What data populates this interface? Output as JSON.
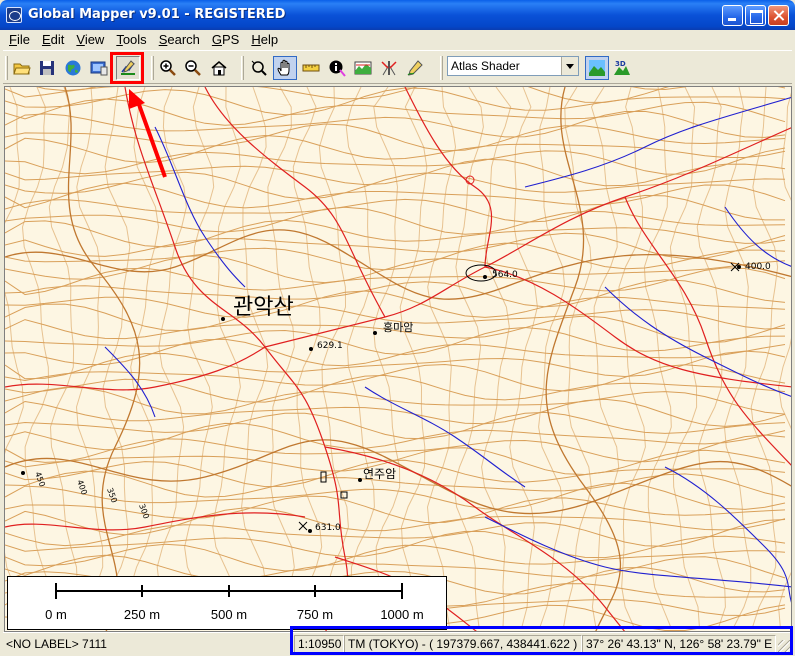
{
  "window": {
    "title": "Global Mapper v9.01 - REGISTERED"
  },
  "menu": {
    "items": [
      {
        "label": "File",
        "key": "F",
        "rest": "ile"
      },
      {
        "label": "Edit",
        "key": "E",
        "rest": "dit"
      },
      {
        "label": "View",
        "key": "V",
        "rest": "iew"
      },
      {
        "label": "Tools",
        "key": "T",
        "rest": "ools"
      },
      {
        "label": "Search",
        "key": "S",
        "rest": "earch"
      },
      {
        "label": "GPS",
        "key": "G",
        "rest": "PS"
      },
      {
        "label": "Help",
        "key": "H",
        "rest": "elp"
      }
    ]
  },
  "toolbar": {
    "icons": [
      "open-folder-icon",
      "save-icon",
      "globe-icon",
      "screen-capture-icon",
      "digitizer-icon",
      "zoom-in-icon",
      "zoom-out-icon",
      "home-icon",
      "zoom-tool-icon",
      "pan-hand-icon",
      "measure-ruler-icon",
      "feature-info-icon",
      "path-profile-icon",
      "3d-view-icon",
      "digitize-pencil-icon"
    ],
    "shader_select": "Atlas Shader",
    "shader_3d_label": "3D"
  },
  "map": {
    "labels": {
      "mountain_name": "관악산",
      "temple_1": "홍마암",
      "temple_2": "연주암",
      "peak_1": "564.0",
      "peak_2": "629.1",
      "peak_3": "631.0",
      "peak_4": "400.0",
      "contour_1": "450",
      "contour_2": "400",
      "contour_3": "350",
      "contour_4": "300"
    },
    "scale_bar": {
      "ticks": [
        "0 m",
        "250 m",
        "500 m",
        "750 m",
        "1000 m"
      ]
    },
    "colors": {
      "background": "#fdf6e3",
      "contour": "#d9a05a",
      "road": "#e02020",
      "stream": "#2020d0"
    }
  },
  "status": {
    "left_text": "<NO LABEL> 7111",
    "scale": "1:10950",
    "projection_coords": "TM (TOKYO) - ( 197379.667, 438441.622 )",
    "latlon": "37° 26' 43.13\" N, 126° 58' 23.79\" E"
  }
}
